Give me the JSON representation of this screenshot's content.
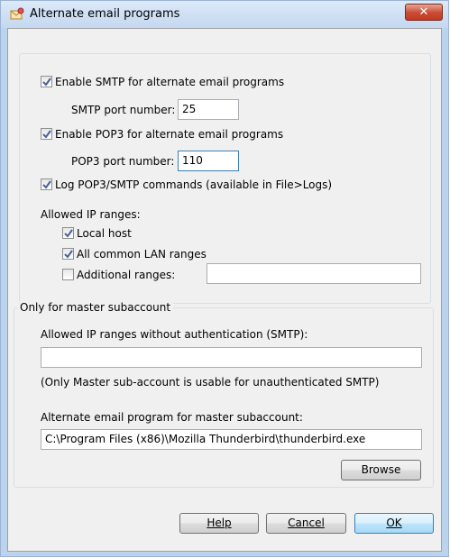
{
  "window": {
    "title": "Alternate email programs",
    "close_glyph": "✕",
    "app_icon": "envelope-with-network-icon"
  },
  "smtp": {
    "enable_label": "Enable SMTP for alternate email programs",
    "enabled": true,
    "port_label": "SMTP port number:",
    "port_value": "25"
  },
  "pop3": {
    "enable_label": "Enable POP3 for alternate email programs",
    "enabled": true,
    "port_label": "POP3 port number:",
    "port_value": "110"
  },
  "log": {
    "label": "Log POP3/SMTP commands (available in File>Logs)",
    "enabled": true
  },
  "allowed_ip": {
    "heading": "Allowed IP ranges:",
    "local_host_label": "Local host",
    "local_host_checked": true,
    "lan_label": "All common LAN ranges",
    "lan_checked": true,
    "additional_label": "Additional ranges:",
    "additional_checked": false,
    "additional_value": ""
  },
  "master": {
    "group_title": "Only for master subaccount",
    "no_auth_label": "Allowed IP ranges without authentication (SMTP):",
    "no_auth_value": "",
    "note": "(Only Master sub-account is usable for unauthenticated SMTP)",
    "program_label": "Alternate email program for master subaccount:",
    "program_path": "C:\\Program Files (x86)\\Mozilla Thunderbird\\thunderbird.exe",
    "browse_label": "Browse"
  },
  "buttons": {
    "help": "Help",
    "cancel": "Cancel",
    "ok": "OK"
  },
  "colors": {
    "title_gradient_top": "#dce9f8",
    "dialog_bg": "#f0f0f0",
    "close_button": "#c94a32",
    "default_button_border": "#3c7fb1"
  }
}
